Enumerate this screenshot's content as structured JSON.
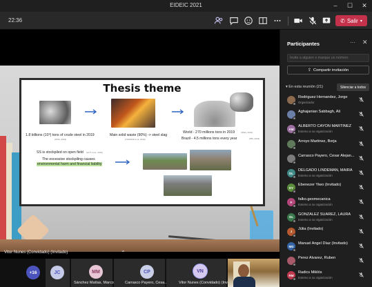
{
  "window": {
    "title": "EIDEIC 2021"
  },
  "toolbar": {
    "timer": "22:36",
    "leave_label": "Salir",
    "colors": {
      "leave": "#c4314b",
      "bar": "#292929"
    }
  },
  "slide": {
    "title": "Thesis theme",
    "steel_text": "1.8 billions (10⁹) tons of crude steel in 2019",
    "steel_note": "(WSA, 2019)",
    "waste_text": "Main solid waste (90%) -> steel slag",
    "waste_note": "(THOMAS et al. 2019)",
    "world_text": "World - 270 millions tons in 2019",
    "world_note": "(IPEA, 2019)",
    "brazil_text": "Brazil - 4.5 millions tons every year",
    "brazil_note": "(IBS, 2019)",
    "ss_text": "SS is stockpiled on open field",
    "ss_note": "(GUT et al., 2019)",
    "excess_text_1": "The excessive stockpiling causes",
    "excess_text_2": "environmental harm and financial liability"
  },
  "spotlight": {
    "label": "Vitor Nunes (Convidado) (Invitado)"
  },
  "strip": {
    "overflow_count": "+16",
    "tiles": [
      {
        "initials": "JC",
        "name": ""
      },
      {
        "initials": "MM",
        "name": "Sánchez Matías, Marcos"
      },
      {
        "initials": "CP",
        "name": "Carrasco Payero, Cesa..."
      },
      {
        "initials": "VN",
        "name": "Vitor Nunes (Convidado) (Invi..."
      }
    ]
  },
  "panel": {
    "title": "Participantes",
    "invite_placeholder": "Invite a alguien o marque un número",
    "share_label": "Compartir invitación",
    "section_label": "En esta reunión (21)",
    "mute_all_label": "Silenciar a todos",
    "participants": [
      {
        "name": "Rodriguez Hernandez, Jorge",
        "sub": "Organizador",
        "initials": "",
        "color": "#8b6a4e"
      },
      {
        "name": "Aghajanian Sabbagh, Ali",
        "sub": "",
        "initials": "",
        "color": "#6b7fa8"
      },
      {
        "name": "ALBERTO CAYON MARTINEZ",
        "sub": "Externo a su organización",
        "initials": "AM",
        "color": "#9a6e9e"
      },
      {
        "name": "Arroyo Martinez, Borja",
        "sub": "",
        "initials": "",
        "color": "#5f7a5a"
      },
      {
        "name": "Carrasco Payero, Cesar Alejan...",
        "sub": "",
        "initials": "",
        "color": "#7c7c7c"
      },
      {
        "name": "DELGADO LINDEMAN, MAIRA",
        "sub": "Externo a su organización",
        "initials": "DL",
        "color": "#3f8a86"
      },
      {
        "name": "Ebenezer Yiwo (Invitado)",
        "sub": "",
        "initials": "EY",
        "color": "#5a8c3a"
      },
      {
        "name": "falko.geomecanica",
        "sub": "Externo a su organización",
        "initials": "F",
        "color": "#b3467a"
      },
      {
        "name": "GONZALEZ SUAREZ, LAURA",
        "sub": "Externo a su organización",
        "initials": "GL",
        "color": "#3b7a4c"
      },
      {
        "name": "Júlia (Invitado)",
        "sub": "",
        "initials": "J",
        "color": "#b45a2e"
      },
      {
        "name": "Manuel Angel Díaz (Invitado)",
        "sub": "",
        "initials": "MD",
        "color": "#3566a8"
      },
      {
        "name": "Perez Alvarez, Ruben",
        "sub": "",
        "initials": "",
        "color": "#a85a6a"
      },
      {
        "name": "Radics Miklós",
        "sub": "Externo a su organización",
        "initials": "RM",
        "color": "#c0394f"
      }
    ]
  }
}
